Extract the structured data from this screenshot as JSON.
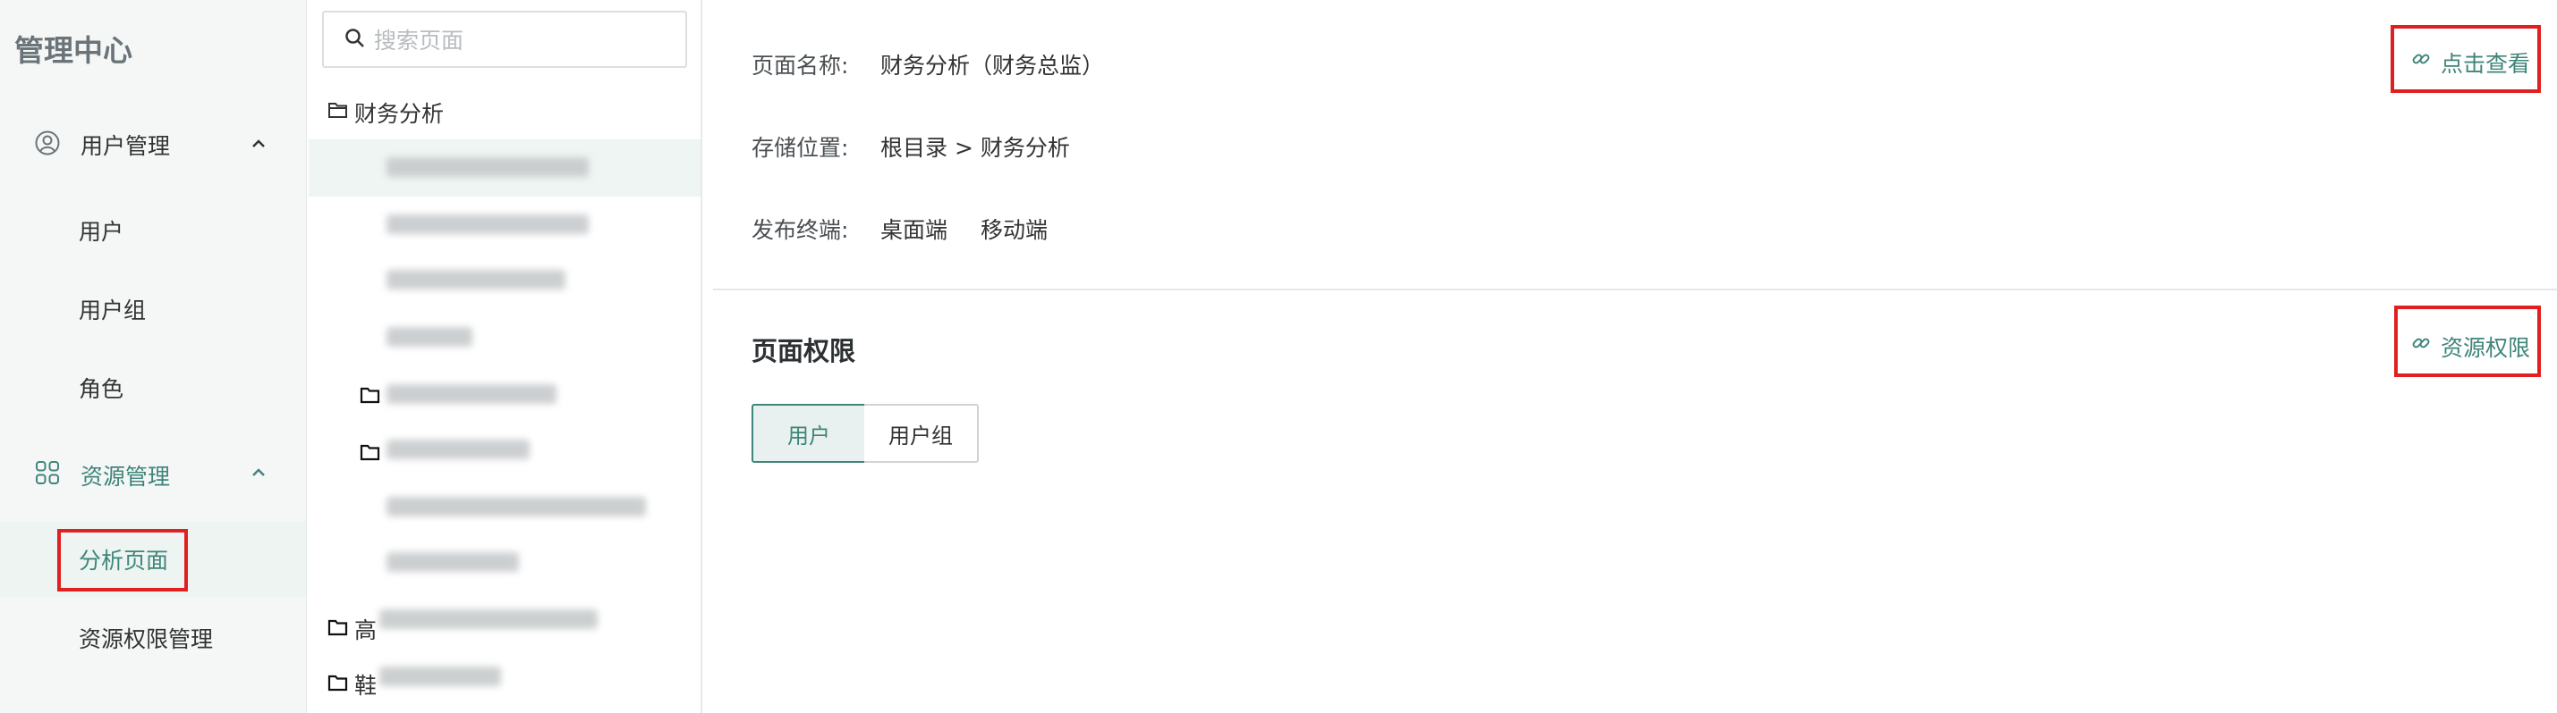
{
  "sidebar": {
    "title": "管理中心",
    "groups": [
      {
        "label": "用户管理",
        "icon": "user-circle-icon",
        "items": [
          "用户",
          "用户组",
          "角色"
        ]
      },
      {
        "label": "资源管理",
        "icon": "grid-icon",
        "items": [
          "分析页面",
          "资源权限管理"
        ],
        "active": "分析页面"
      }
    ]
  },
  "tree": {
    "search_placeholder": "搜索页面",
    "root_folder": "财务分析",
    "folder_gao": "高",
    "folder_xie": "鞋"
  },
  "details": {
    "page_name_label": "页面名称:",
    "page_name_value": "财务分析（财务总监）",
    "storage_label": "存储位置:",
    "storage_value": "根目录 > 财务分析",
    "publish_label": "发布终端:",
    "publish_values": [
      "桌面端",
      "移动端"
    ],
    "view_link": "点击查看"
  },
  "permissions": {
    "title": "页面权限",
    "resource_link": "资源权限",
    "tabs": [
      "用户",
      "用户组"
    ],
    "active_tab": "用户"
  },
  "colors": {
    "accent": "#3f857a",
    "highlight": "#e02020"
  }
}
